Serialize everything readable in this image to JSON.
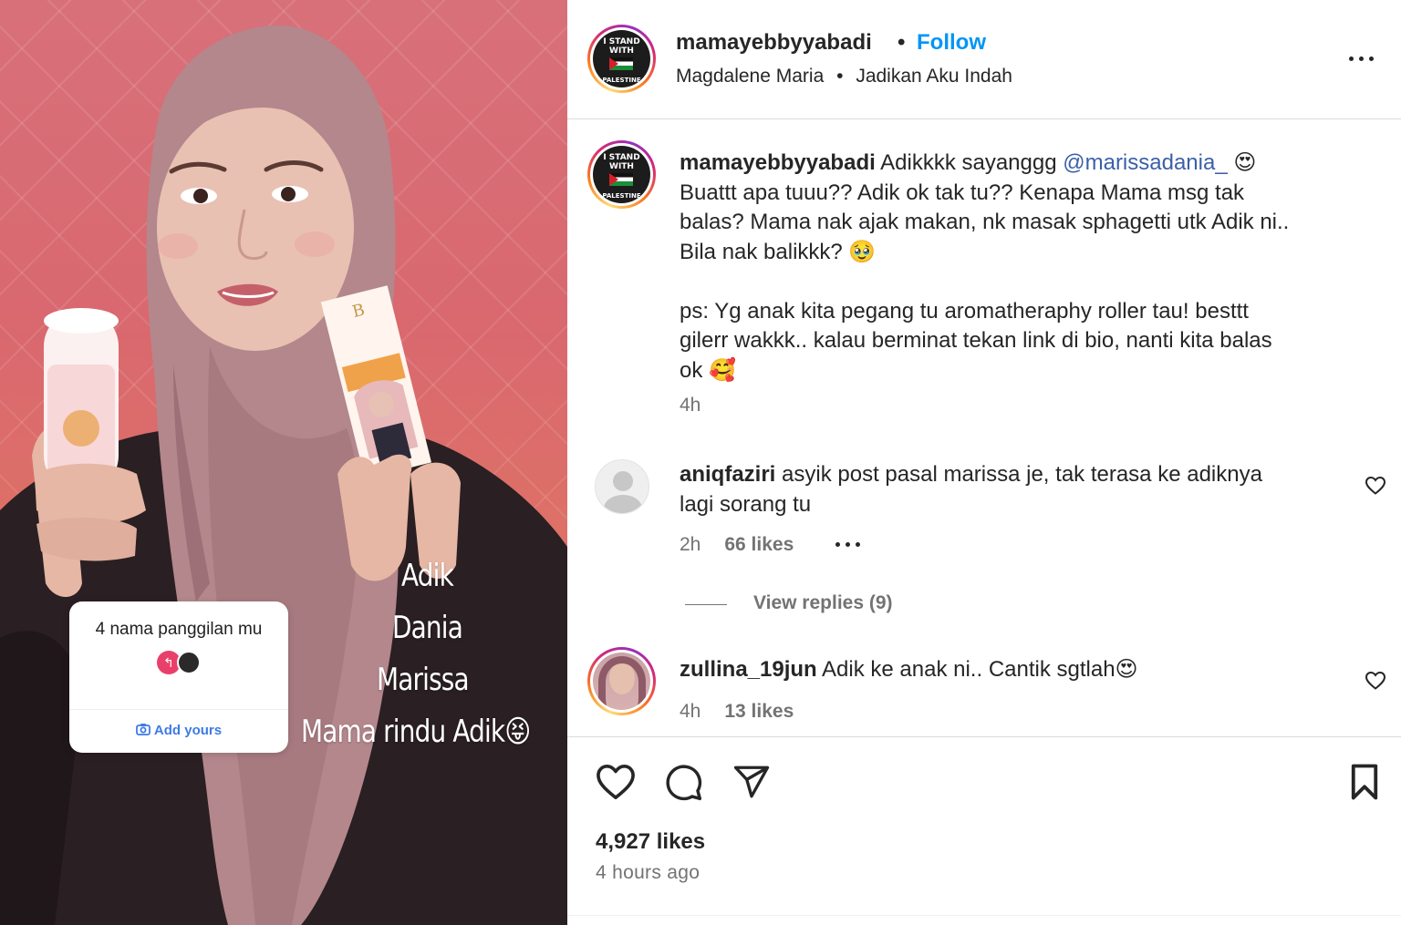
{
  "media": {
    "overlay_lines": [
      "Adik",
      "Dania",
      "Marissa",
      "Mama rindu Adik😝"
    ],
    "story_sticker": {
      "question": "4 nama panggilan mu",
      "add_label": "Add yours"
    }
  },
  "header": {
    "username": "mamayebbyyabadi",
    "separator": "•",
    "follow_label": "Follow",
    "audio_artist": "Magdalene Maria",
    "audio_title": "Jadikan Aku Indah",
    "avatar_badge_lines": [
      "I STAND",
      "WITH",
      "PALESTINE"
    ]
  },
  "caption": {
    "username": "mamayebbyyabadi",
    "text_start": " Adikkkk sayanggg ",
    "mention": "@marissadania_",
    "lines": [
      "Buattt apa tuuu?? Adik ok tak tu?? Kenapa Mama msg tak",
      "balas? Mama nak ajak makan, nk masak sphagetti utk Adik ni..",
      "Bila nak balikkk? 🥹",
      "",
      "ps: Yg anak kita pegang tu aromatheraphy roller tau! besttt",
      "gilerr wakkk.. kalau berminat tekan link di bio, nanti kita balas",
      "ok 🥰"
    ],
    "emoji_end": "😍",
    "time": "4h"
  },
  "comments": [
    {
      "username": "aniqfaziri",
      "line1": " asyik post pasal marissa je, tak terasa ke adiknya",
      "line2": "lagi sorang tu",
      "time": "2h",
      "likes": "66 likes",
      "view_replies": "View replies (9)"
    },
    {
      "username": "zullina_19jun",
      "text": " Adik ke anak ni.. Cantik sgtlah😍",
      "time": "4h",
      "likes": "13 likes"
    }
  ],
  "footer": {
    "likes": "4,927 likes",
    "posted": "4 hours ago"
  },
  "colors": {
    "link_blue": "#0095f6",
    "mention_blue": "#3b5fa8",
    "meta_gray": "#737373",
    "text": "#262626"
  },
  "icons": [
    "more-options-icon",
    "heart-icon",
    "comment-icon",
    "share-icon",
    "bookmark-icon",
    "camera-icon",
    "reply-icon"
  ]
}
